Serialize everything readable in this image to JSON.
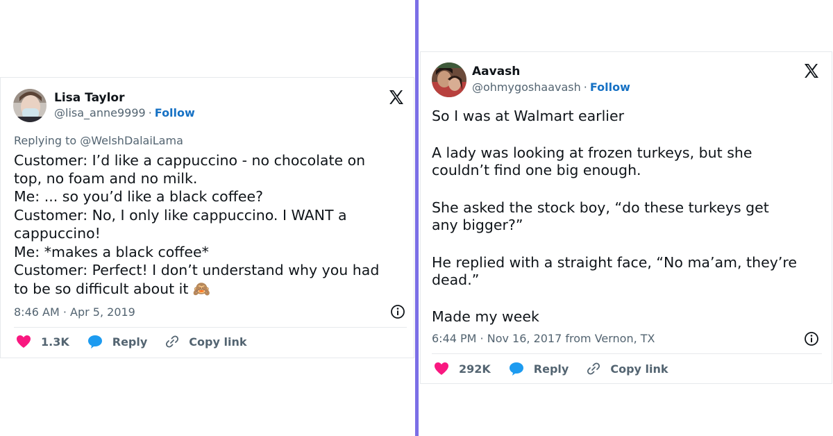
{
  "left_tweet": {
    "author_name": "Lisa Taylor",
    "handle": "@lisa_anne9999",
    "separator": "·",
    "follow_label": "Follow",
    "platform_icon": "x-logo-icon",
    "reply_to": "Replying to @WelshDalaiLama",
    "body_lines": [
      "Customer: I’d like a cappuccino - no chocolate on",
      "top, no foam and no milk.",
      "Me: ... so you’d like a black coffee?",
      "Customer: No, I only like cappuccino. I WANT a",
      "cappuccino!",
      "Me: *makes a black coffee*",
      "Customer: Perfect! I don’t understand why you had",
      "to be so difficult about it 🙈"
    ],
    "timestamp": "8:46 AM · Apr 5, 2019",
    "like_count": "1.3K",
    "reply_label": "Reply",
    "copy_link_label": "Copy link"
  },
  "right_tweet": {
    "author_name": "Aavash",
    "handle": "@ohmygoshaavash",
    "separator": "·",
    "follow_label": "Follow",
    "platform_icon": "x-logo-icon",
    "body_lines": [
      "So I was at Walmart earlier",
      "A lady was looking at frozen turkeys, but she",
      "couldn’t find one big enough.",
      "She asked the stock boy, “do these turkeys get",
      "any bigger?”",
      "He replied with a straight face, “No ma’am, they’re",
      "dead.”",
      "Made my week"
    ],
    "timestamp": "6:44 PM · Nov 16, 2017 from Vernon, TX",
    "like_count": "292K",
    "reply_label": "Reply",
    "copy_link_label": "Copy link"
  },
  "colors": {
    "divider": "#7b6fe6",
    "heart": "#f91880",
    "reply_bubble": "#1d9bf0",
    "follow": "#1671c4",
    "muted_text": "#536471"
  }
}
